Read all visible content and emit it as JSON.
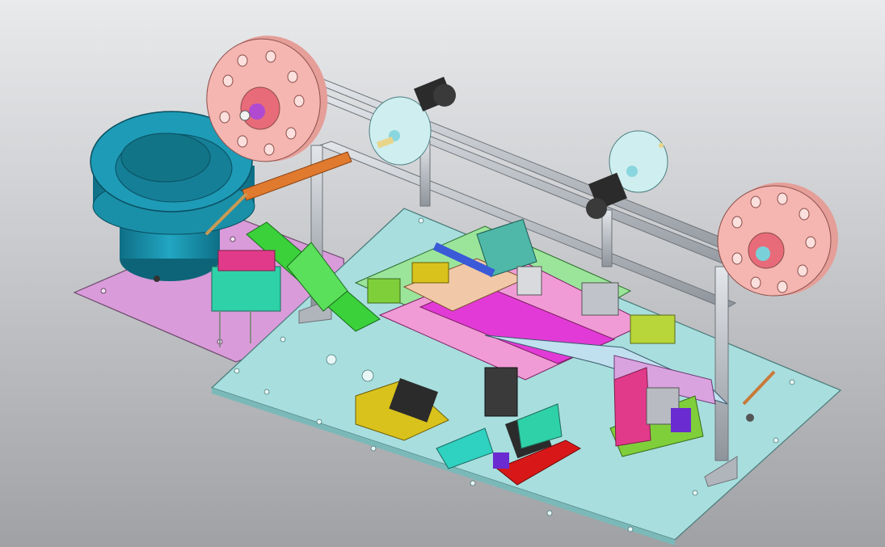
{
  "viewport": {
    "background_top": "#e9eaec",
    "background_bottom": "#9fa1a4",
    "labels": []
  },
  "palette": {
    "base_plate": "#a8dede",
    "feeder_plate": "#d99bd9",
    "vibratory_bowl": "#1a8fa8",
    "reel_large": "#f5b5b0",
    "reel_small": "#cfeeef",
    "aluminum_profile": "#c9cdd2",
    "camera_body": "#2b2b2b",
    "chute_green": "#3ad13a",
    "arm_orange": "#e07a2e",
    "component_magenta": "#e23ad6",
    "component_yellow": "#d9c21c",
    "component_red": "#d81818",
    "component_lime": "#7fcf3a",
    "component_blue": "#3a5ad8"
  }
}
